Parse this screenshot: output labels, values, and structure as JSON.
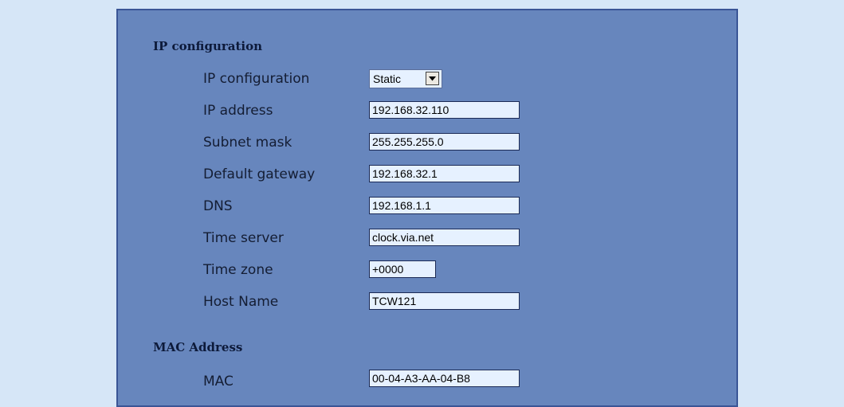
{
  "ip_section": {
    "title": "IP configuration",
    "ip_config": {
      "label": "IP configuration",
      "value": "Static"
    },
    "ip_address": {
      "label": "IP address",
      "value": "192.168.32.110"
    },
    "subnet_mask": {
      "label": "Subnet mask",
      "value": "255.255.255.0"
    },
    "default_gateway": {
      "label": "Default gateway",
      "value": "192.168.32.1"
    },
    "dns": {
      "label": "DNS",
      "value": "192.168.1.1"
    },
    "time_server": {
      "label": "Time server",
      "value": "clock.via.net"
    },
    "time_zone": {
      "label": "Time zone",
      "value": "+0000"
    },
    "host_name": {
      "label": "Host Name",
      "value": "TCW121"
    }
  },
  "mac_section": {
    "title": "MAC Address",
    "mac": {
      "label": "MAC",
      "value": "00-04-A3-AA-04-B8"
    }
  },
  "icons": {
    "select_arrow": "chevron-down-icon"
  },
  "colors": {
    "page_background": "#d6e6f7",
    "panel_background": "#6786bd",
    "field_background": "#e6f1ff"
  }
}
